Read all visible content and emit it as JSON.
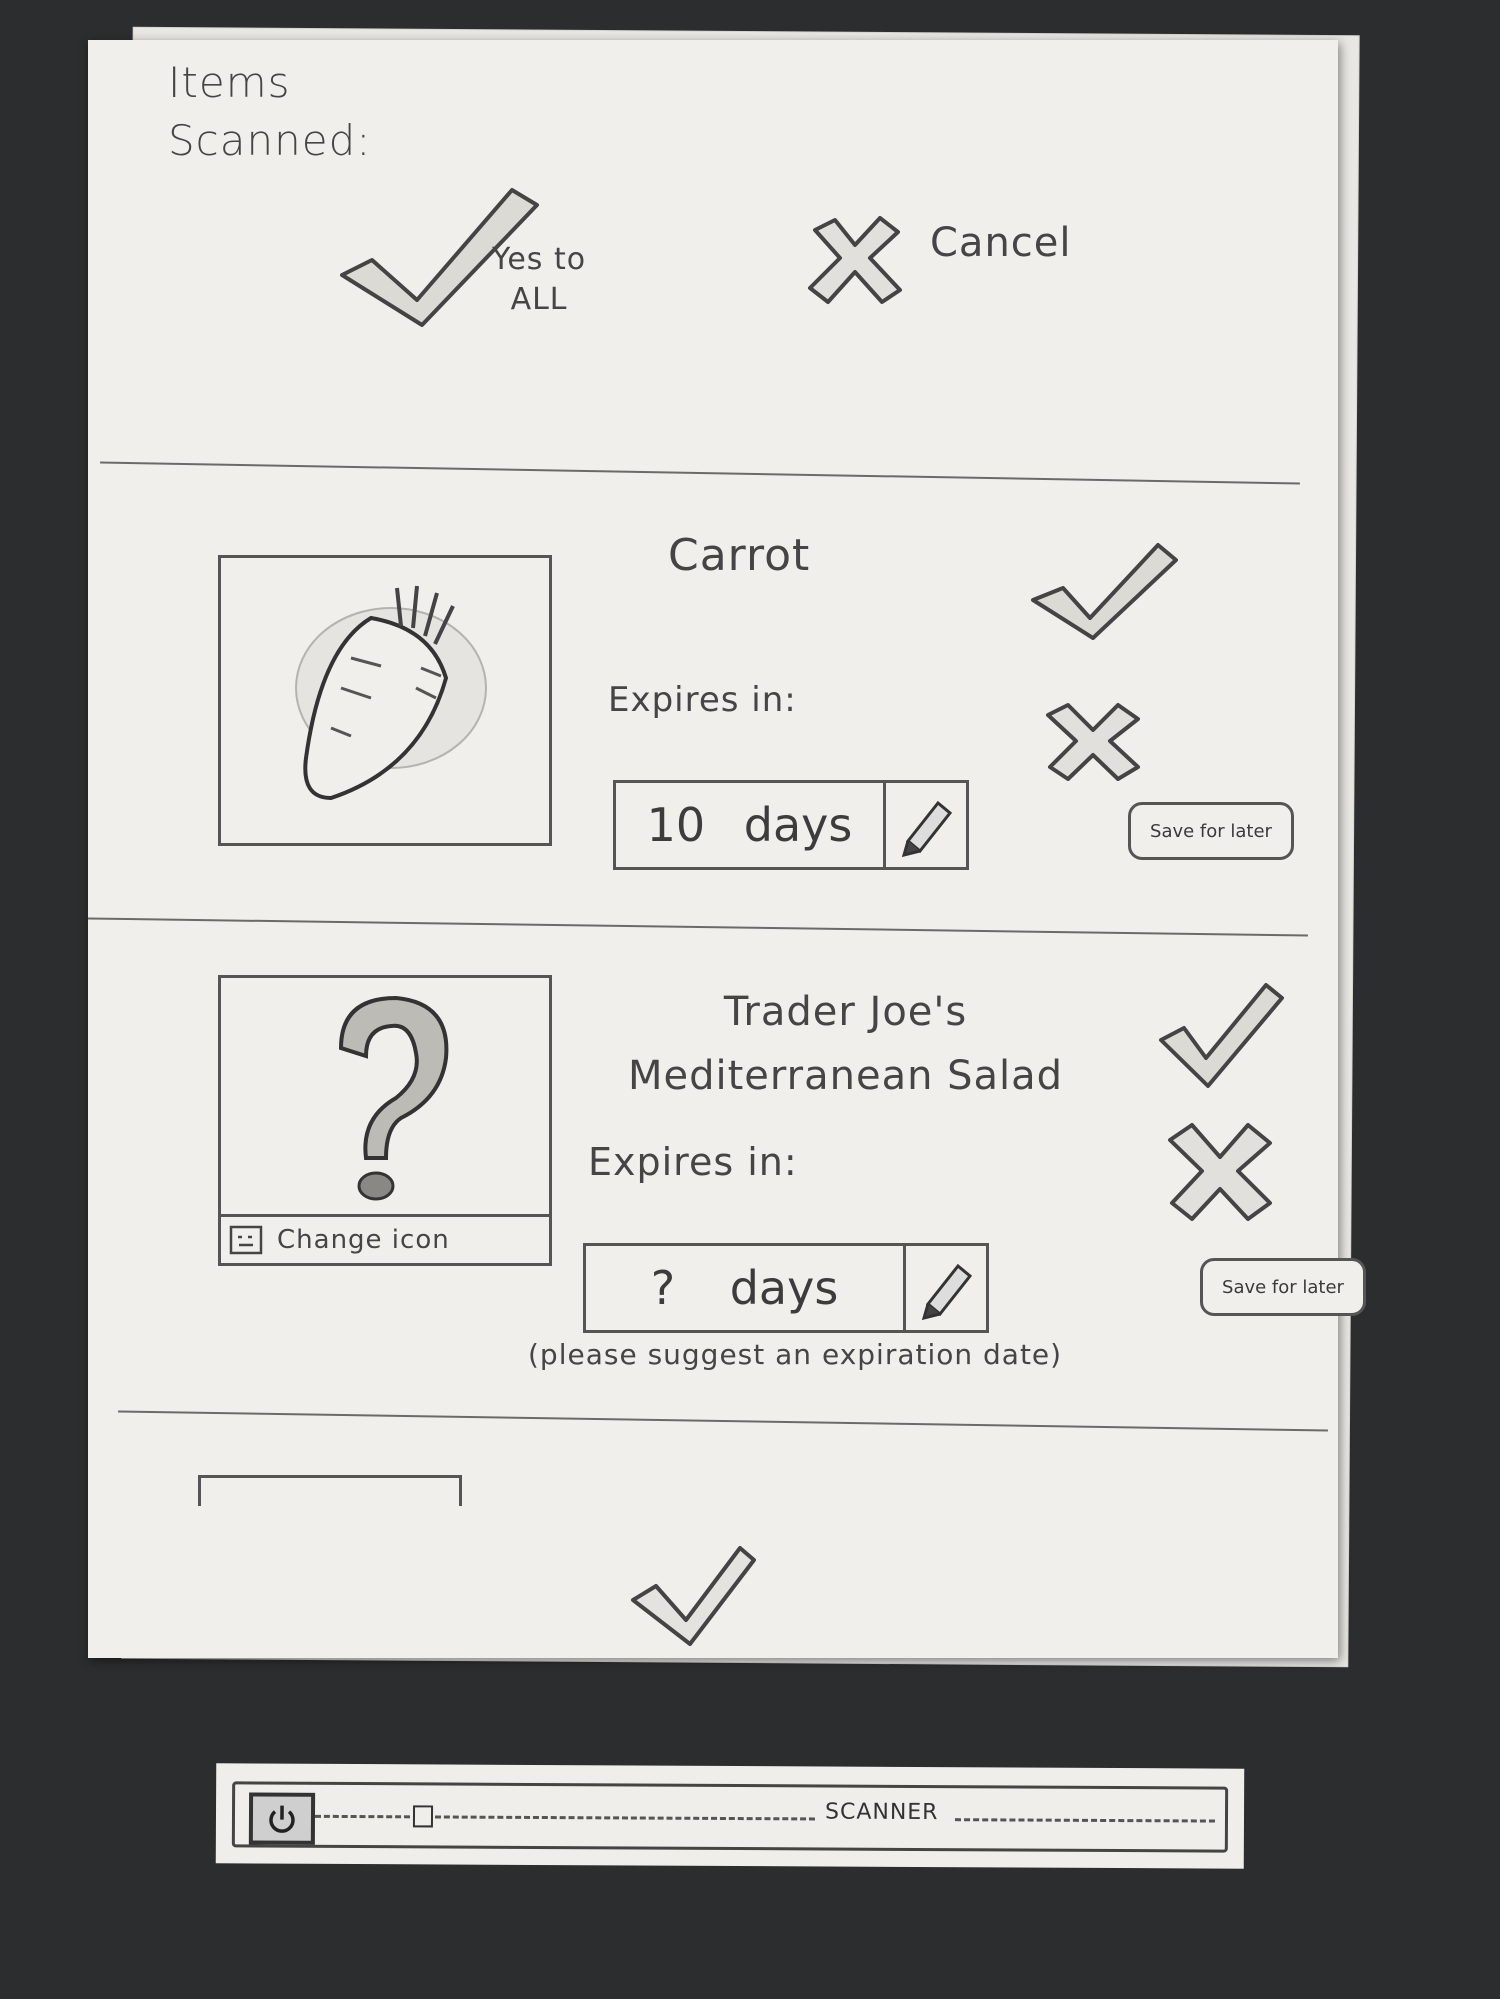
{
  "header": {
    "title_line1": "Items",
    "title_line2": "Scanned:",
    "yes_to_all_line1": "Yes to",
    "yes_to_all_line2": "ALL",
    "cancel_label": "Cancel"
  },
  "items": [
    {
      "name": "Carrot",
      "expires_label": "Expires in:",
      "expiration_value": "10",
      "expiration_unit": "days",
      "save_label": "Save for later",
      "icon": "carrot-icon"
    },
    {
      "name_line1": "Trader Joe's",
      "name_line2": "Mediterranean Salad",
      "expires_label": "Expires in:",
      "expiration_value": "?",
      "expiration_unit": "days",
      "hint": "(please suggest an expiration date)",
      "change_icon_label": "Change icon",
      "save_label": "Save for later",
      "icon": "question-mark-icon"
    }
  ],
  "scanner": {
    "label": "SCANNER",
    "power_icon": "power-icon"
  }
}
